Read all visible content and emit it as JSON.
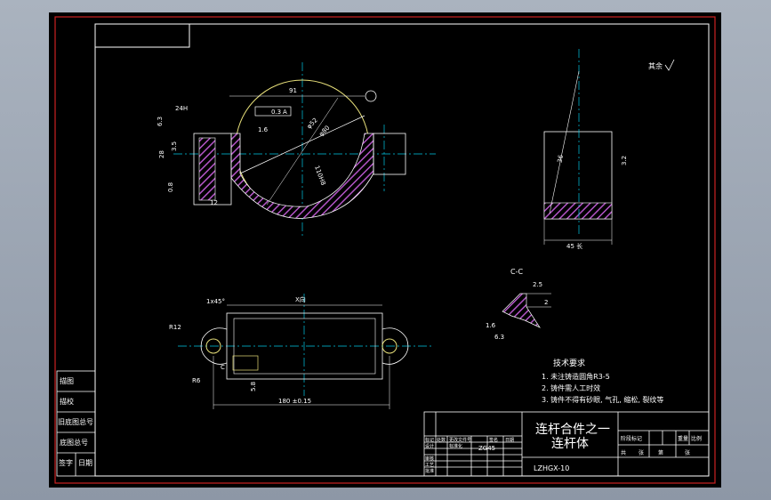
{
  "title_block": {
    "drawing_title_line1": "连杆合件之一",
    "drawing_title_line2": "连杆体",
    "drawing_number": "LZHGX-10",
    "material": "ZG45",
    "small_labels": [
      "标记",
      "处数",
      "更改文件号",
      "签名",
      "日期",
      "设计",
      "标准化",
      "审核",
      "工艺",
      "批准"
    ],
    "right_labels": [
      "阶段标记",
      "重量",
      "比例",
      "共",
      "张",
      "第",
      "张"
    ]
  },
  "left_table": {
    "rows": [
      "描图",
      "描校",
      "旧底图总号",
      "底图总号",
      "签字",
      "日期"
    ]
  },
  "tech_requirements": {
    "heading": "技术要求",
    "items": [
      "1. 未注铸造圆角R3-5",
      "2. 铸件需人工时效",
      "3. 铸件不得有砂眼, 气孔, 缩松, 裂纹等"
    ]
  },
  "surface_note": "其余",
  "section_label": "C-C",
  "dimensions": {
    "top_width": "91",
    "phi_a": "φ52",
    "phi_b": "φ80",
    "dim_110": "110H8",
    "dim_24": "24H",
    "dim_28": "28",
    "tol_03": "0.3",
    "tol_a": "A",
    "dim_12": "12",
    "dim_35": "3.5",
    "dim_63": "6.3",
    "dim_08": "0.8",
    "dim_16": "1.6",
    "right_36": "36",
    "right_45": "45 长",
    "right_32": "3.2",
    "cc_25": "2.5",
    "cc_2": "2",
    "cc_63": "6.3",
    "cc_16": "1.6",
    "bottom_top": "X向",
    "bottom_width": "180 ±0.15",
    "bottom_R12": "R12",
    "bottom_R6": "R6",
    "bottom_C": "C",
    "bottom_58": "5.8",
    "bottom_angle": "1x45°"
  },
  "colors": {
    "background": "#000000",
    "frame": "#ffffff",
    "outer_border": "#cc2222",
    "hatch": "#b455c8",
    "centerline": "#00c8e6",
    "circle": "#e8e07a",
    "text": "#ffffff"
  }
}
